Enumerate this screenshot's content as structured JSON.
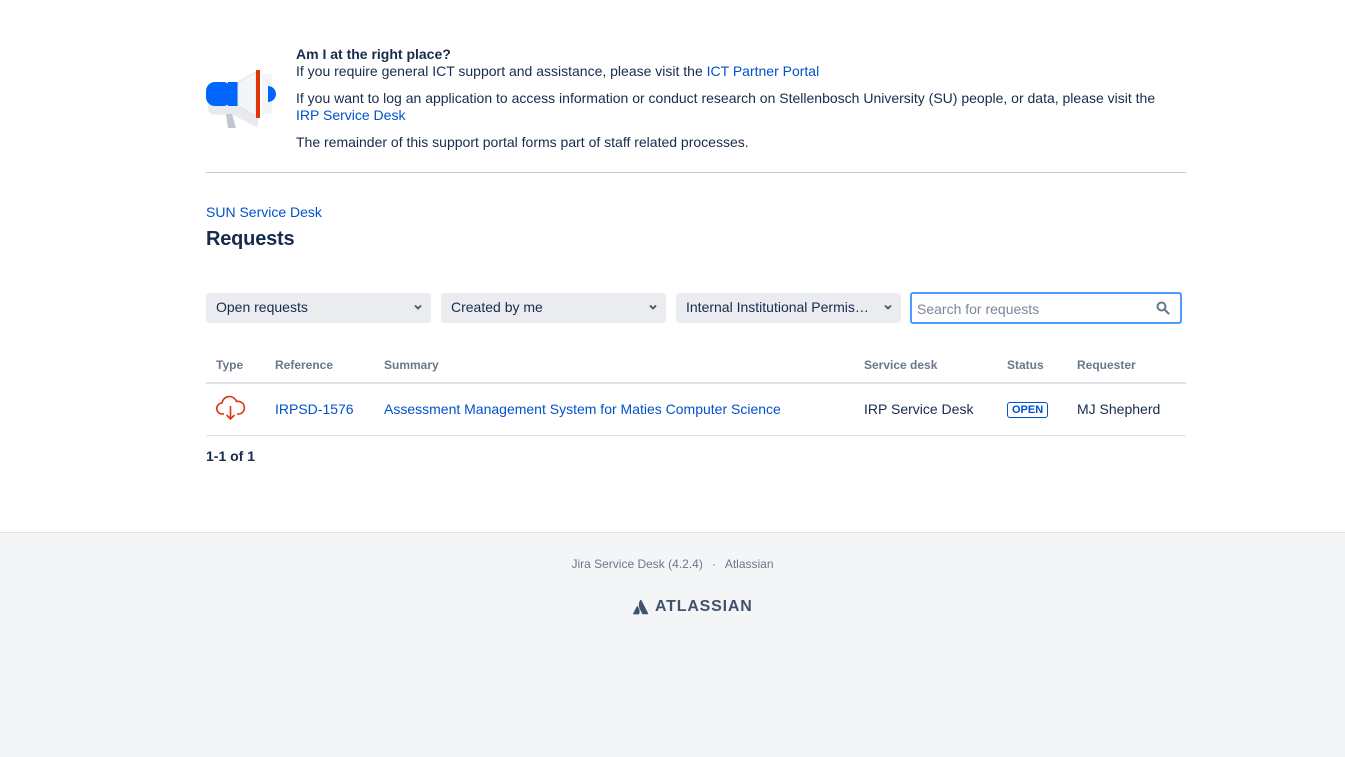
{
  "announcement": {
    "title": "Am I at the right place?",
    "line1_text": "If you require general ICT support and assistance, please visit the ",
    "line1_link": "ICT Partner Portal",
    "line2_text": "If you want to log an application to access information or conduct research on Stellenbosch University (SU) people, or data, please visit the ",
    "line2_link": "IRP Service Desk",
    "line3_text": "The remainder of this support portal forms part of staff related processes.",
    "icon": "megaphone-icon"
  },
  "breadcrumb": "SUN Service Desk",
  "page_title": "Requests",
  "filters": [
    {
      "label": "Open requests"
    },
    {
      "label": "Created by me"
    },
    {
      "label": "Internal Institutional Permission (IRP) Service Desk"
    }
  ],
  "search": {
    "placeholder": "Search for requests"
  },
  "table": {
    "headers": [
      "Type",
      "Reference",
      "Summary",
      "Service desk",
      "Status",
      "Requester"
    ],
    "rows": [
      {
        "type_icon": "cloud-download-icon",
        "reference": "IRPSD-1576",
        "summary": "Assessment Management System for Maties Computer Science",
        "service_desk": "IRP Service Desk",
        "status": "OPEN",
        "requester": "MJ Shepherd"
      }
    ]
  },
  "pagination": "1-1 of 1",
  "footer": {
    "product": "Jira Service Desk (4.2.4)",
    "separator": "·",
    "company": "Atlassian",
    "logo_text": "ATLASSIAN"
  },
  "colors": {
    "link": "#0052cc",
    "text": "#172b4d",
    "accent_blue": "#0065ff",
    "accent_red": "#de350b",
    "footer_bg": "#f4f5f7"
  }
}
